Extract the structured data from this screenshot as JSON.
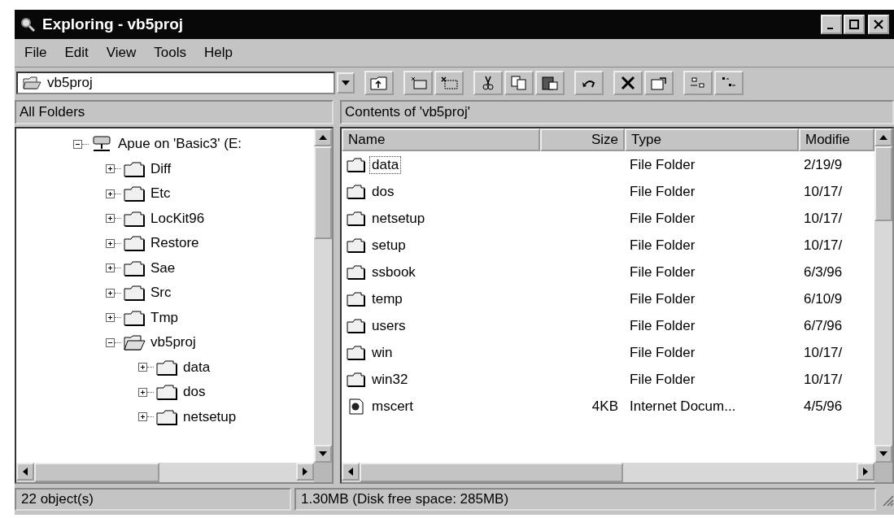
{
  "window": {
    "title": "Exploring - vb5proj"
  },
  "menu": [
    "File",
    "Edit",
    "View",
    "Tools",
    "Help"
  ],
  "address": {
    "value": "vb5proj"
  },
  "left_pane": {
    "title": "All Folders"
  },
  "tree": [
    {
      "label": "Apue on 'Basic3' (E:",
      "kind": "drive",
      "expanded": true,
      "children": [
        {
          "label": "Diff",
          "kind": "folder",
          "expanded": false
        },
        {
          "label": "Etc",
          "kind": "folder",
          "expanded": false
        },
        {
          "label": "LocKit96",
          "kind": "folder",
          "expanded": false
        },
        {
          "label": "Restore",
          "kind": "folder",
          "expanded": false
        },
        {
          "label": "Sae",
          "kind": "folder",
          "expanded": false
        },
        {
          "label": "Src",
          "kind": "folder",
          "expanded": false
        },
        {
          "label": "Tmp",
          "kind": "folder",
          "expanded": false
        },
        {
          "label": "vb5proj",
          "kind": "open-folder",
          "expanded": true,
          "children": [
            {
              "label": "data",
              "kind": "folder",
              "expanded": false
            },
            {
              "label": "dos",
              "kind": "folder",
              "expanded": false
            },
            {
              "label": "netsetup",
              "kind": "folder",
              "expanded": false
            }
          ]
        }
      ]
    }
  ],
  "right_pane": {
    "title": "Contents of 'vb5proj'"
  },
  "table": {
    "columns": [
      "Name",
      "Size",
      "Type",
      "Modifie"
    ],
    "rows": [
      {
        "name": "data",
        "size": "",
        "type": "File Folder",
        "modified": "2/19/9",
        "kind": "folder",
        "focused": true
      },
      {
        "name": "dos",
        "size": "",
        "type": "File Folder",
        "modified": "10/17/",
        "kind": "folder",
        "focused": false
      },
      {
        "name": "netsetup",
        "size": "",
        "type": "File Folder",
        "modified": "10/17/",
        "kind": "folder",
        "focused": false
      },
      {
        "name": "setup",
        "size": "",
        "type": "File Folder",
        "modified": "10/17/",
        "kind": "folder",
        "focused": false
      },
      {
        "name": "ssbook",
        "size": "",
        "type": "File Folder",
        "modified": "6/3/96",
        "kind": "folder",
        "focused": false
      },
      {
        "name": "temp",
        "size": "",
        "type": "File Folder",
        "modified": "6/10/9",
        "kind": "folder",
        "focused": false
      },
      {
        "name": "users",
        "size": "",
        "type": "File Folder",
        "modified": "6/7/96",
        "kind": "folder",
        "focused": false
      },
      {
        "name": "win",
        "size": "",
        "type": "File Folder",
        "modified": "10/17/",
        "kind": "folder",
        "focused": false
      },
      {
        "name": "win32",
        "size": "",
        "type": "File Folder",
        "modified": "10/17/",
        "kind": "folder",
        "focused": false
      },
      {
        "name": "mscert",
        "size": "4KB",
        "type": "Internet Docum...",
        "modified": "4/5/96",
        "kind": "document",
        "focused": false
      }
    ]
  },
  "status_bar": [
    "22 object(s)",
    "1.30MB (Disk free space: 285MB)"
  ]
}
